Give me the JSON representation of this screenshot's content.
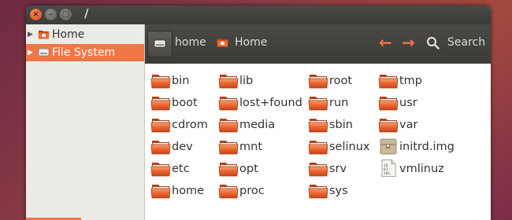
{
  "window": {
    "title": "/"
  },
  "window_buttons": {
    "close": "×",
    "minimize": "–",
    "maximize": "□"
  },
  "sidebar": {
    "items": [
      {
        "label": "Home",
        "icon": "home-folder-icon",
        "expanded": false,
        "selected": false
      },
      {
        "label": "File System",
        "icon": "drive-icon",
        "expanded": false,
        "selected": true
      }
    ]
  },
  "toolbar": {
    "breadcrumbs": [
      {
        "label": "",
        "icon": "drive-icon"
      },
      {
        "label": "home"
      },
      {
        "label": "Home",
        "icon": "home-folder-icon"
      }
    ],
    "back_glyph": "←",
    "forward_glyph": "→",
    "search_label": "Search"
  },
  "files": {
    "col1": [
      "bin",
      "boot",
      "cdrom",
      "dev",
      "etc",
      "home"
    ],
    "col2": [
      "lib",
      "lost+found",
      "media",
      "mnt",
      "opt",
      "proc"
    ],
    "col3": [
      "root",
      "run",
      "sbin",
      "selinux",
      "srv",
      "sys"
    ],
    "col4": [
      {
        "name": "tmp",
        "icon": "folder-icon"
      },
      {
        "name": "usr",
        "icon": "folder-icon"
      },
      {
        "name": "var",
        "icon": "folder-icon"
      },
      {
        "name": "initrd.img",
        "icon": "archive-file-icon"
      },
      {
        "name": "vmlinuz",
        "icon": "binary-file-icon"
      }
    ]
  },
  "colors": {
    "accent": "#f07746",
    "folder": "#e95420",
    "toolbar": "#3c3b37"
  }
}
